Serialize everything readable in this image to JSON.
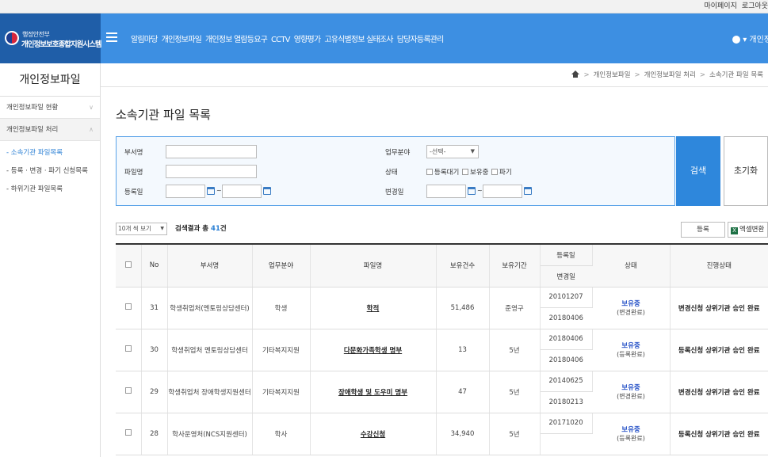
{
  "topbar": {
    "mypage": "마이페이지",
    "logout": "로그아웃"
  },
  "header": {
    "logo_small": "행정안전부",
    "logo_main": "개인정보보호종합지원시스템",
    "nav": [
      "알림마당",
      "개인정보파일",
      "개인정보 열람등요구",
      "CCTV",
      "영향평가",
      "고유식별정보 실태조사",
      "담당자등록관리"
    ],
    "user": "▾ 개인정보"
  },
  "sidebar": {
    "title": "개인정보파일",
    "items": [
      {
        "label": "개인정보파일 현황"
      },
      {
        "label": "개인정보파일 처리"
      }
    ],
    "subitems": [
      "- 소속기관 파일목록",
      "- 등록 · 변경 · 파기 신청목록",
      "- 하위기관 파일목록"
    ]
  },
  "breadcrumb": [
    "개인정보파일",
    "개인정보파일 처리",
    "소속기관 파일 목록"
  ],
  "page_title": "소속기관 파일 목록",
  "search": {
    "dept_label": "부서명",
    "file_label": "파일명",
    "regdate_label": "등록일",
    "field_label": "업무분야",
    "field_value": "-선택-",
    "status_label": "상태",
    "status_opts": [
      "등록대기",
      "보유중",
      "파기"
    ],
    "chgdate_label": "변경일",
    "tilde": "~",
    "search_btn": "검색",
    "reset_btn": "초기화"
  },
  "list": {
    "perpage": "10개 씩 보기",
    "count_prefix": "검색결과 총 ",
    "count": "41",
    "count_suffix": "건",
    "reg_btn": "등록",
    "excel_btn": "엑셀변환"
  },
  "table": {
    "headers": {
      "no": "No",
      "dept": "부서명",
      "field": "업무분야",
      "file": "파일명",
      "holdings": "보유건수",
      "period": "보유기간",
      "reg": "등록일",
      "chg": "변경일",
      "status": "상태",
      "progress": "진행상태"
    },
    "rows": [
      {
        "no": "31",
        "dept": "학생취업처(멘토링상담센터)",
        "field": "학생",
        "file": "학적",
        "holdings": "51,486",
        "period": "준영구",
        "reg": "20101207",
        "chg": "20180406",
        "status": "보유중",
        "status_sub": "(변경완료)",
        "progress": "변경신청 상위기관 승인 완료"
      },
      {
        "no": "30",
        "dept": "학생취업처 멘토링상담센터",
        "field": "기타복지지원",
        "file": "다문화가족학생 명부",
        "holdings": "13",
        "period": "5년",
        "reg": "20180406",
        "chg": "20180406",
        "status": "보유중",
        "status_sub": "(등록완료)",
        "progress": "등록신청 상위기관 승인 완료"
      },
      {
        "no": "29",
        "dept": "학생취업처 장애학생지원센터",
        "field": "기타복지지원",
        "file": "장애학생 및 도우미 명부",
        "holdings": "47",
        "period": "5년",
        "reg": "20140625",
        "chg": "20180213",
        "status": "보유중",
        "status_sub": "(변경완료)",
        "progress": "변경신청 상위기관 승인 완료"
      },
      {
        "no": "28",
        "dept": "학사운영처(NCS지원센터)",
        "field": "학사",
        "file": "수강신청",
        "holdings": "34,940",
        "period": "5년",
        "reg": "20171020",
        "chg": "",
        "status": "보유중",
        "status_sub": "(등록완료)",
        "progress": "등록신청 상위기관 승인 완료"
      }
    ]
  }
}
